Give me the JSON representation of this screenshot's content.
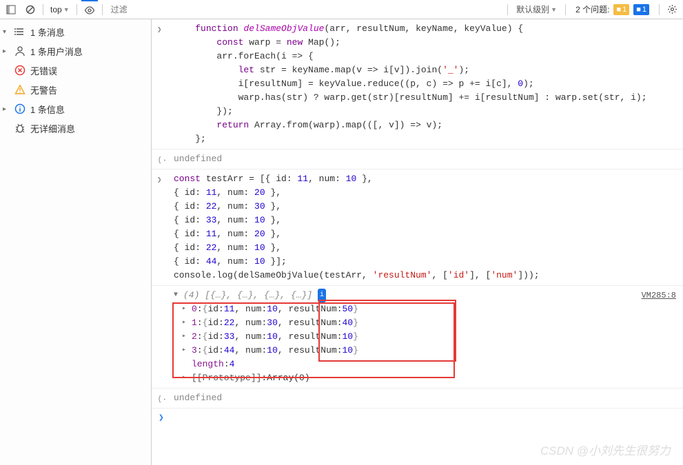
{
  "toolbar": {
    "context": "top",
    "filter_placeholder": "过滤",
    "level": "默认级别",
    "issues_text": "2 个问题:",
    "issue_warn": "1",
    "issue_info": "1"
  },
  "sidebar": {
    "items": [
      {
        "caret": "▾",
        "icon": "list",
        "label": "1 条消息"
      },
      {
        "caret": "▸",
        "icon": "user",
        "label": "1 条用户消息"
      },
      {
        "caret": "",
        "icon": "error",
        "label": "无错误"
      },
      {
        "caret": "",
        "icon": "warn",
        "label": "无警告"
      },
      {
        "caret": "▸",
        "icon": "info",
        "label": "1 条信息"
      },
      {
        "caret": "",
        "icon": "bug",
        "label": "无详细消息"
      }
    ]
  },
  "code1": {
    "l1a": "function",
    "l1b": "delSameObjValue",
    "l1c": "(arr, resultNum, keyName, keyValue) {",
    "l2a": "const",
    "l2b": " warp = ",
    "l2c": "new",
    "l2d": " Map();",
    "l3": "        arr.forEach(i => {",
    "l4a": "let",
    "l4b": " str = keyName.map(v => i[v]).join(",
    "l4c": "'_'",
    "l4d": ");",
    "l5a": "            i[resultNum] = keyValue.reduce((p, c) => p += i[c], ",
    "l5b": "0",
    "l5c": ");",
    "l6": "            warp.has(str) ? warp.get(str)[resultNum] += i[resultNum] : warp.set(str, i);",
    "l7": "        });",
    "l8a": "return",
    "l8b": " Array.from(warp).map(([, v]) => v);",
    "l9": "    };"
  },
  "ret1": "undefined",
  "code2": {
    "h1a": "const",
    "h1b": " testArr = [{ id: ",
    "h1c": "11",
    "h1d": ", num: ",
    "h1e": "10",
    "h1f": " },",
    "rows": [
      {
        "id": "11",
        "num": "20"
      },
      {
        "id": "22",
        "num": "30"
      },
      {
        "id": "33",
        "num": "10"
      },
      {
        "id": "11",
        "num": "20"
      },
      {
        "id": "22",
        "num": "10"
      },
      {
        "id": "44",
        "num": "10"
      }
    ],
    "log1": "console.log(delSameObjValue(testArr, ",
    "log2": "'resultNum'",
    "log3": ", [",
    "log4": "'id'",
    "log5": "], [",
    "log6": "'num'",
    "log7": "]));"
  },
  "output": {
    "head": "(4) [{…}, {…}, {…}, {…}]",
    "badge": "i",
    "src": "VM285:8",
    "rows": [
      {
        "idx": "0",
        "id": "11",
        "num": "10",
        "rn": "50"
      },
      {
        "idx": "1",
        "id": "22",
        "num": "30",
        "rn": "40"
      },
      {
        "idx": "2",
        "id": "33",
        "num": "10",
        "rn": "10"
      },
      {
        "idx": "3",
        "id": "44",
        "num": "10",
        "rn": "10"
      }
    ],
    "length_label": "length",
    "length_val": "4",
    "proto": "[[Prototype]]",
    "proto_val": "Array(0)"
  },
  "ret2": "undefined",
  "watermark": "CSDN @小刘先生很努力"
}
